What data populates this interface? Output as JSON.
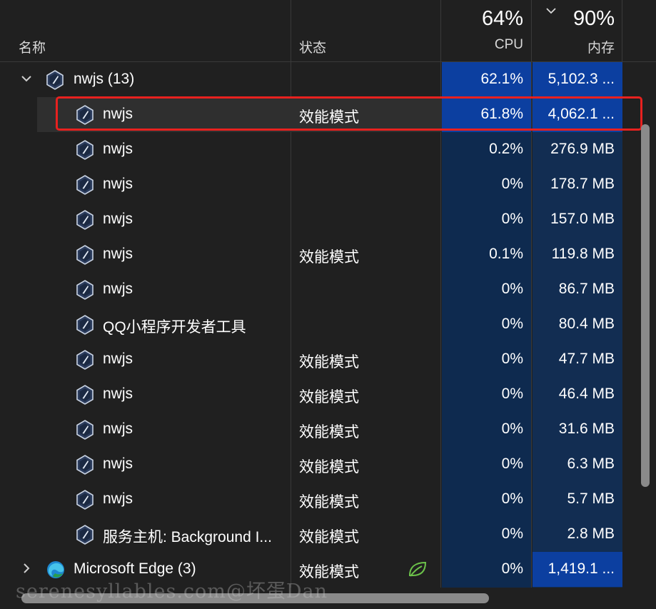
{
  "header": {
    "col_name": "名称",
    "col_status": "状态",
    "cpu_total": "64%",
    "cpu_label": "CPU",
    "mem_total": "90%",
    "mem_label": "内存",
    "sort_indicator": "chevron-down-icon"
  },
  "colors": {
    "background": "#202020",
    "cpu_band": "#0e2a4f",
    "highlight": "#0c3fa0",
    "selection_outline": "#e8211f",
    "efficiency_leaf": "#6cc24a"
  },
  "rows": [
    {
      "name": "nwjs (13)",
      "status": "",
      "cpu": "62.1%",
      "mem": "5,102.3 ...",
      "group": true,
      "expanded": true,
      "icon": "nwjs-icon"
    },
    {
      "name": "nwjs",
      "status": "效能模式",
      "cpu": "61.8%",
      "mem": "4,062.1 ...",
      "selected": true,
      "icon": "nwjs-icon"
    },
    {
      "name": "nwjs",
      "status": "",
      "cpu": "0.2%",
      "mem": "276.9 MB",
      "icon": "nwjs-icon"
    },
    {
      "name": "nwjs",
      "status": "",
      "cpu": "0%",
      "mem": "178.7 MB",
      "icon": "nwjs-icon"
    },
    {
      "name": "nwjs",
      "status": "",
      "cpu": "0%",
      "mem": "157.0 MB",
      "icon": "nwjs-icon"
    },
    {
      "name": "nwjs",
      "status": "效能模式",
      "cpu": "0.1%",
      "mem": "119.8 MB",
      "icon": "nwjs-icon"
    },
    {
      "name": "nwjs",
      "status": "",
      "cpu": "0%",
      "mem": "86.7 MB",
      "icon": "nwjs-icon"
    },
    {
      "name": "QQ小程序开发者工具",
      "status": "",
      "cpu": "0%",
      "mem": "80.4 MB",
      "icon": "nwjs-icon"
    },
    {
      "name": "nwjs",
      "status": "效能模式",
      "cpu": "0%",
      "mem": "47.7 MB",
      "icon": "nwjs-icon"
    },
    {
      "name": "nwjs",
      "status": "效能模式",
      "cpu": "0%",
      "mem": "46.4 MB",
      "icon": "nwjs-icon"
    },
    {
      "name": "nwjs",
      "status": "效能模式",
      "cpu": "0%",
      "mem": "31.6 MB",
      "icon": "nwjs-icon"
    },
    {
      "name": "nwjs",
      "status": "效能模式",
      "cpu": "0%",
      "mem": "6.3 MB",
      "icon": "nwjs-icon"
    },
    {
      "name": "nwjs",
      "status": "效能模式",
      "cpu": "0%",
      "mem": "5.7 MB",
      "icon": "nwjs-icon"
    },
    {
      "name": "服务主机: Background I...",
      "status": "效能模式",
      "cpu": "0%",
      "mem": "2.8 MB",
      "icon": "nwjs-icon"
    },
    {
      "name": "Microsoft Edge (3)",
      "status": "效能模式",
      "cpu": "0%",
      "mem": "1,419.1 ...",
      "group": true,
      "expanded": false,
      "icon": "edge-icon",
      "leaf_icon": "leaf-icon"
    }
  ],
  "watermark": "serenesyllables.com@坏蛋Dan"
}
